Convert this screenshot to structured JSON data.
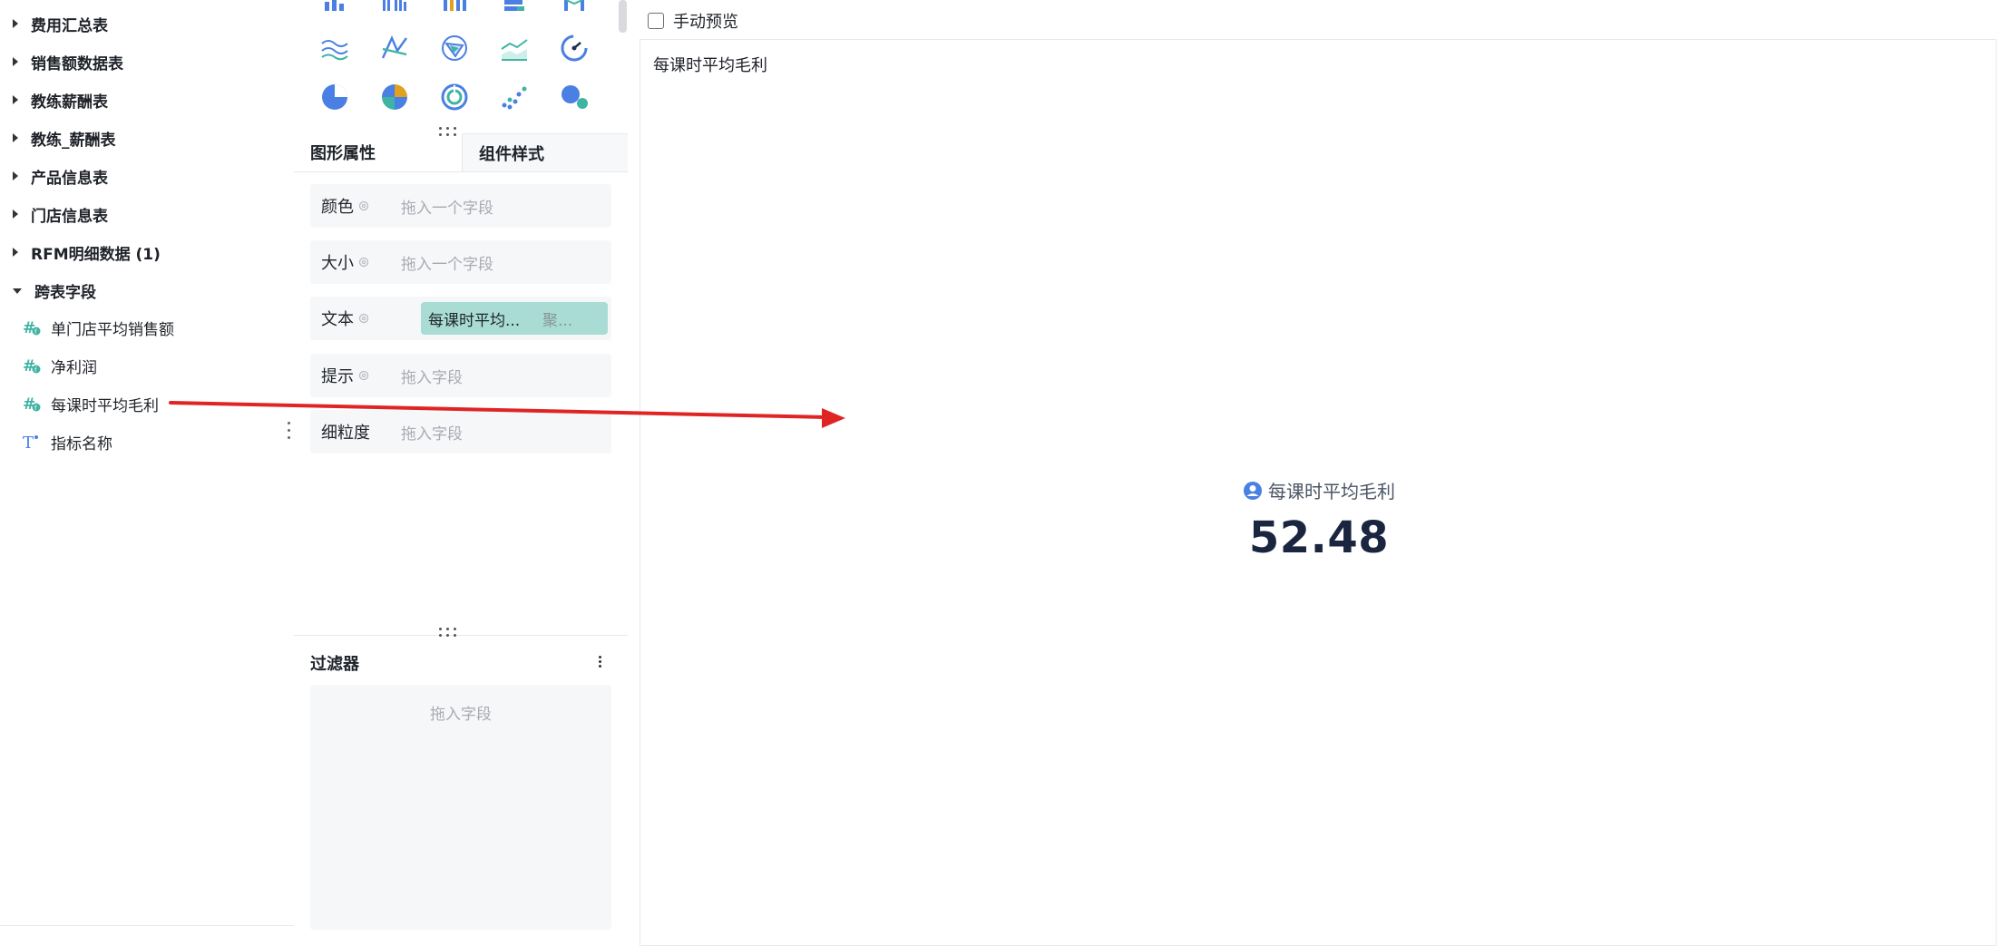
{
  "tree": {
    "tables": [
      {
        "label": "费用汇总表",
        "expanded": false
      },
      {
        "label": "销售额数据表",
        "expanded": false
      },
      {
        "label": "教练薪酬表",
        "expanded": false
      },
      {
        "label": "教练_薪酬表",
        "expanded": false
      },
      {
        "label": "产品信息表",
        "expanded": false
      },
      {
        "label": "门店信息表",
        "expanded": false
      },
      {
        "label": "RFM明细数据 (1)",
        "expanded": false
      },
      {
        "label": "跨表字段",
        "expanded": true
      }
    ],
    "fields": [
      {
        "label": "单门店平均销售额",
        "icon": "calculated-number-icon"
      },
      {
        "label": "净利润",
        "icon": "calculated-number-icon"
      },
      {
        "label": "每课时平均毛利",
        "icon": "calculated-number-icon"
      },
      {
        "label": "指标名称",
        "icon": "text-field-icon"
      }
    ]
  },
  "chart_types": [
    "bar-chart-icon",
    "grouped-bar-icon",
    "stacked-bar-icon",
    "horizontal-bar-icon",
    "column-combo-icon",
    "wave-line-icon",
    "cross-line-icon",
    "radar-icon",
    "area-line-icon",
    "gauge-icon",
    "pie-icon",
    "quadrant-pie-icon",
    "ring-icon",
    "scatter-icon",
    "bubble-icon"
  ],
  "tabs": {
    "graphic_props": "图形属性",
    "component_style": "组件样式"
  },
  "props": {
    "color": {
      "label": "颜色",
      "placeholder": "拖入一个字段"
    },
    "size": {
      "label": "大小",
      "placeholder": "拖入一个字段"
    },
    "text": {
      "label": "文本",
      "pill_field": "每课时平均...",
      "pill_agg": "聚..."
    },
    "tooltip": {
      "label": "提示",
      "placeholder": "拖入字段"
    },
    "granularity": {
      "label": "细粒度",
      "placeholder": "拖入字段"
    }
  },
  "filter": {
    "title": "过滤器",
    "placeholder": "拖入字段"
  },
  "preview": {
    "manual_preview_label": "手动预览",
    "card_title": "每课时平均毛利",
    "kpi_label": "每课时平均毛利",
    "kpi_value": "52.48"
  },
  "colors": {
    "accent_teal": "#3fb3a4",
    "pill_bg": "#a8dcd4",
    "annotation_red": "#e02424",
    "chart_blue": "#4a7fe3"
  }
}
